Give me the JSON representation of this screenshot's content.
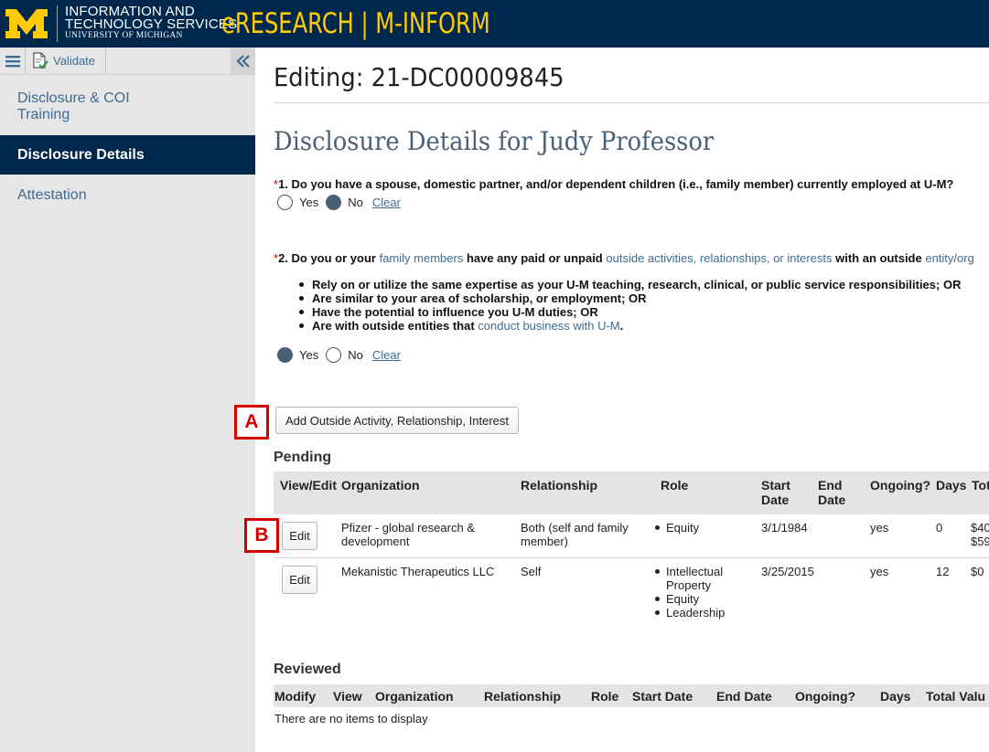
{
  "header": {
    "logo_letter": "M",
    "org_line1": "INFORMATION AND",
    "org_line2": "TECHNOLOGY SERVICES",
    "org_line3": "UNIVERSITY OF MICHIGAN",
    "app_title": "eRESEARCH | M-INFORM",
    "logo_color": "#ffcb05",
    "header_bg": "#00274c"
  },
  "toolbar": {
    "menu_icon": "hamburger-icon",
    "validate_icon": "validate-document-icon",
    "validate_label": "Validate",
    "collapse_icon": "double-chevron-left-icon"
  },
  "sidebar": {
    "items": [
      {
        "label": "Disclosure & COI Training",
        "active": false
      },
      {
        "label": "Disclosure Details",
        "active": true
      },
      {
        "label": "Attestation",
        "active": false
      }
    ]
  },
  "main": {
    "editing_title": "Editing: 21-DC00009845",
    "section_title": "Disclosure Details for  Judy Professor",
    "q1": {
      "required_mark": "*",
      "text": "1. Do you have a spouse, domestic partner, and/or dependent children (i.e., family member) currently employed at U-M?",
      "yes_label": "Yes",
      "no_label": "No",
      "selected": "No",
      "clear_label": "Clear"
    },
    "q2": {
      "required_mark": "*",
      "text_start": "2. Do you or your ",
      "link1": "family members",
      "text_mid": " have any paid or unpaid ",
      "link2": "outside activities, relationships, or interests",
      "text_end": " with an outside ",
      "link3": "entity/org",
      "bullets": [
        "Rely on or utilize the same expertise as your U-M teaching, research, clinical, or public service responsibilities; OR",
        "Are similar to your area of scholarship, or employment; OR",
        "Have the potential to influence you U-M duties; OR"
      ],
      "bullet4_start": "Are with outside entities that ",
      "bullet4_link": "conduct business with U-M",
      "bullet4_end": ".",
      "yes_label": "Yes",
      "no_label": "No",
      "selected": "Yes",
      "clear_label": "Clear"
    },
    "marker_a": "A",
    "marker_b": "B",
    "add_button_label": "Add Outside Activity, Relationship, Interest",
    "pending": {
      "heading": "Pending",
      "columns": [
        "View/Edit",
        "Organization",
        "Relationship",
        "Role",
        "Start Date",
        "End Date",
        "Ongoing?",
        "Days",
        "Tot"
      ],
      "rows": [
        {
          "action": "Edit",
          "organization": "Pfizer - global research & development",
          "relationship": "Both (self and family member)",
          "roles": [
            "Equity"
          ],
          "start_date": "3/1/1984",
          "end_date": "",
          "ongoing": "yes",
          "days": "0",
          "total_line1": "$40",
          "total_line2": "$59"
        },
        {
          "action": "Edit",
          "organization": "Mekanistic Therapeutics LLC",
          "relationship": "Self",
          "roles": [
            "Intellectual Property",
            "Equity",
            "Leadership"
          ],
          "start_date": "3/25/2015",
          "end_date": "",
          "ongoing": "yes",
          "days": "12",
          "total_line1": "$0",
          "total_line2": ""
        }
      ]
    },
    "reviewed": {
      "heading": "Reviewed",
      "columns": [
        "Modify",
        "View",
        "Organization",
        "Relationship",
        "Role",
        "Start Date",
        "End Date",
        "Ongoing?",
        "Days",
        "Total Valu"
      ],
      "empty_message": "There are no items to display"
    },
    "colors": {
      "link": "#3f6b93",
      "section_title": "#4a6178",
      "marker_red": "#d40000",
      "radio_selected": "#4a5f73"
    }
  }
}
